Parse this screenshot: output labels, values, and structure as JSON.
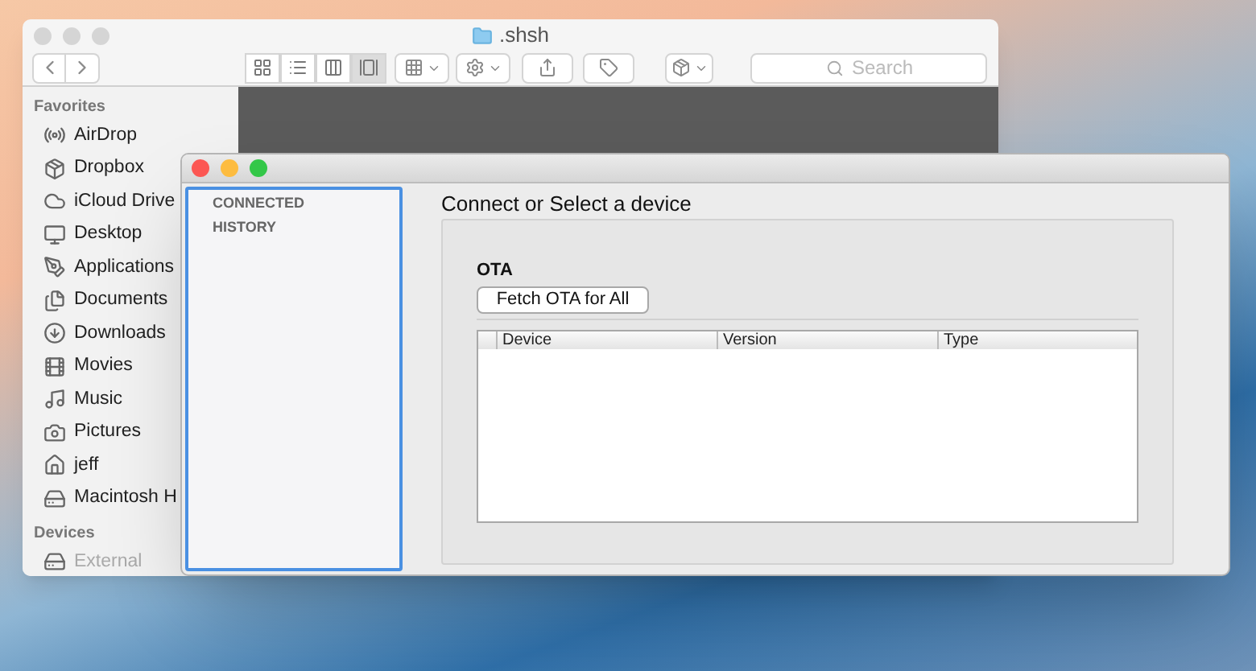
{
  "finder": {
    "title": ".shsh",
    "view_modes": [
      {
        "selected": false
      },
      {
        "selected": false
      },
      {
        "selected": false
      },
      {
        "selected": true
      }
    ],
    "search": {
      "placeholder": "Search"
    },
    "sidebar": [
      {
        "heading": "Favorites",
        "items": [
          {
            "label": "AirDrop"
          },
          {
            "label": "Dropbox"
          },
          {
            "label": "iCloud Drive"
          },
          {
            "label": "Desktop"
          },
          {
            "label": "Applications"
          },
          {
            "label": "Documents"
          },
          {
            "label": "Downloads"
          },
          {
            "label": "Movies"
          },
          {
            "label": "Music"
          },
          {
            "label": "Pictures"
          },
          {
            "label": "jeff"
          },
          {
            "label": "Macintosh H"
          }
        ]
      },
      {
        "heading": "Devices",
        "items": [
          {
            "label": "External",
            "disabled": true
          }
        ]
      }
    ]
  },
  "app": {
    "sidebar_sections": [
      "CONNECTED",
      "HISTORY"
    ],
    "heading": "Connect or Select a device",
    "group": {
      "label": "OTA",
      "button": "Fetch OTA for All"
    },
    "table": {
      "columns": [
        "Device",
        "Version",
        "Type"
      ]
    }
  }
}
